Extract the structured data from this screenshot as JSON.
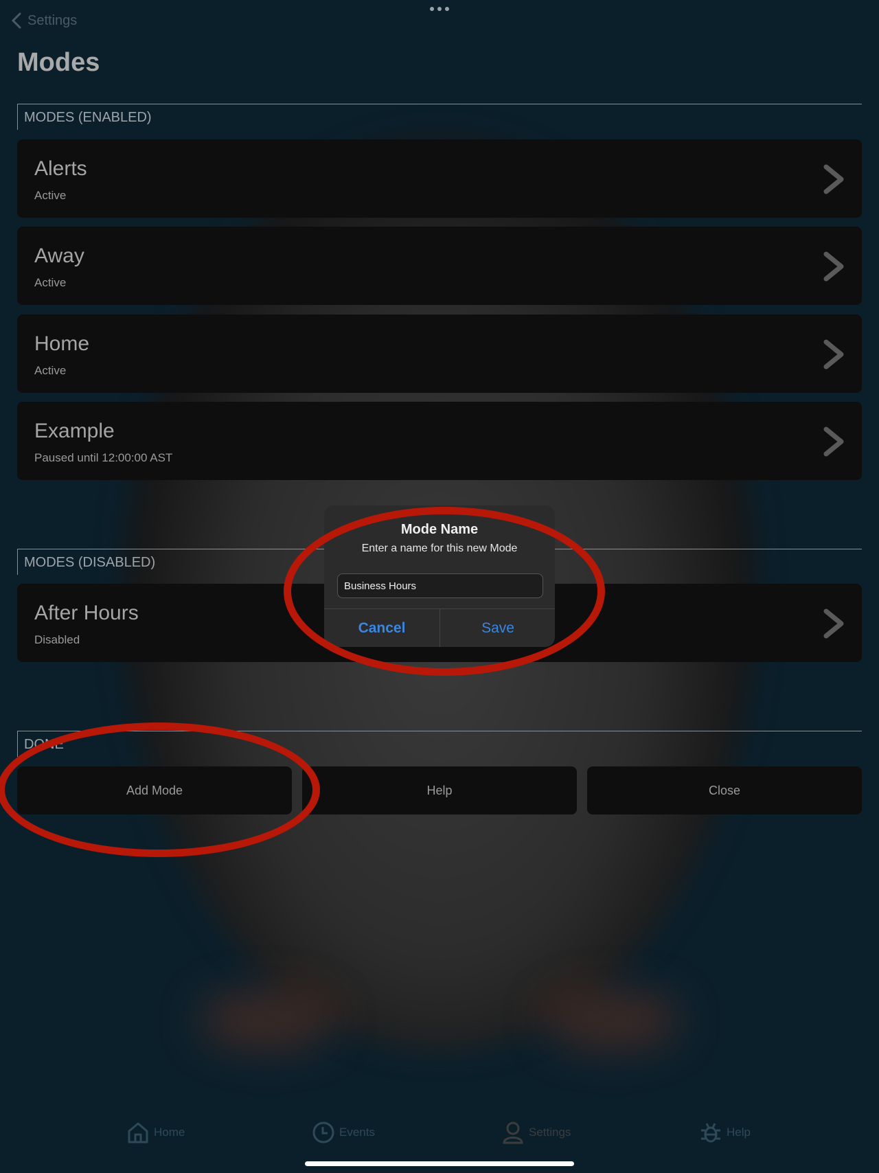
{
  "nav": {
    "back_label": "Settings",
    "title": "Modes",
    "more_icon": "more-dots-icon"
  },
  "sections": {
    "enabled": {
      "header": "MODES (ENABLED)"
    },
    "disabled": {
      "header": "MODES (DISABLED)"
    },
    "done": {
      "header": "DONE"
    }
  },
  "modes_enabled": [
    {
      "name": "Alerts",
      "status": "Active"
    },
    {
      "name": "Away",
      "status": "Active"
    },
    {
      "name": "Home",
      "status": "Active"
    },
    {
      "name": "Example",
      "status": "Paused until 12:00:00 AST"
    }
  ],
  "modes_disabled": [
    {
      "name": "After Hours",
      "status": "Disabled"
    }
  ],
  "actions": {
    "add_mode": "Add Mode",
    "help": "Help",
    "close": "Close"
  },
  "dialog": {
    "title": "Mode Name",
    "message": "Enter a name for this new Mode",
    "input_value": "Business Hours",
    "cancel_label": "Cancel",
    "save_label": "Save"
  },
  "tabbar": [
    {
      "label": "Home",
      "icon": "home-icon"
    },
    {
      "label": "Events",
      "icon": "clock-icon"
    },
    {
      "label": "Settings",
      "icon": "person-icon"
    },
    {
      "label": "Help",
      "icon": "bug-icon"
    }
  ],
  "colors": {
    "accent": "#3a86e0",
    "annotation": "#b81808",
    "background": "#0b1f2b"
  }
}
